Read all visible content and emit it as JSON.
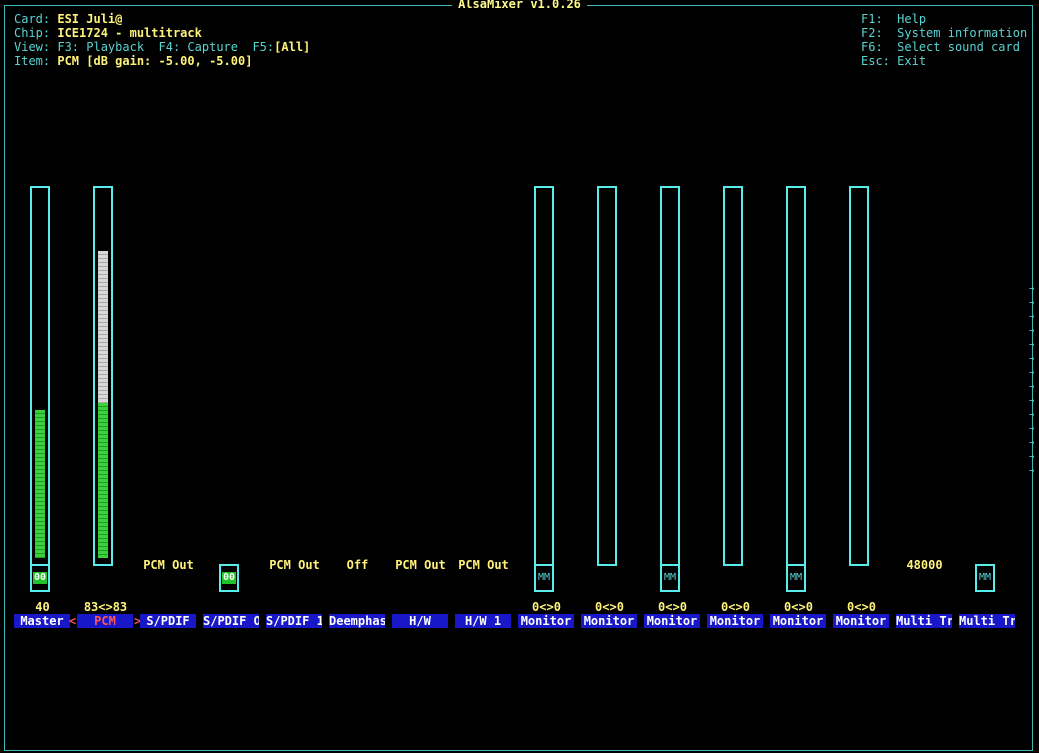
{
  "title": "AlsaMixer v1.0.26",
  "info": {
    "card_label": "Card:",
    "card": "ESI Juli@",
    "chip_label": "Chip:",
    "chip": "ICE1724 - multitrack",
    "view_label": "View:",
    "view_playback": "F3: Playback",
    "view_capture": "F4: Capture",
    "view_f5": "F5:",
    "view_all": "[All]",
    "item_label": "Item:",
    "item": "PCM [dB gain: -5.00, -5.00]"
  },
  "help": [
    {
      "key": "F1:",
      "label": "Help"
    },
    {
      "key": "F2:",
      "label": "System information"
    },
    {
      "key": "F6:",
      "label": "Select sound card"
    },
    {
      "key": "Esc:",
      "label": "Exit"
    }
  ],
  "channels": [
    {
      "name": "Master",
      "value": "40",
      "bar": {
        "green": 0.4
      },
      "switch": "00"
    },
    {
      "name": "PCM",
      "value": "83<>83",
      "bar": {
        "green": 0.42,
        "white": 0.83
      },
      "selected": true
    },
    {
      "name": "S/PDIF",
      "enum": "PCM Out"
    },
    {
      "name": "S/PDIF O",
      "switch": "00"
    },
    {
      "name": "S/PDIF 1",
      "enum": "PCM Out"
    },
    {
      "name": "Deemphas",
      "enum": "Off"
    },
    {
      "name": "H/W",
      "enum": "PCM Out"
    },
    {
      "name": "H/W 1",
      "enum": "PCM Out"
    },
    {
      "name": "Monitor",
      "value": "0<>0",
      "bar": {},
      "switch": "MM"
    },
    {
      "name": "Monitor",
      "value": "0<>0",
      "bar": {}
    },
    {
      "name": "Monitor",
      "value": "0<>0",
      "bar": {},
      "switch": "MM"
    },
    {
      "name": "Monitor",
      "value": "0<>0",
      "bar": {}
    },
    {
      "name": "Monitor",
      "value": "0<>0",
      "bar": {},
      "switch": "MM"
    },
    {
      "name": "Monitor",
      "value": "0<>0",
      "bar": {}
    },
    {
      "name": "Multi Tr",
      "enum": "48000"
    },
    {
      "name": "Multi Tr",
      "switch": "MM"
    }
  ],
  "selection_markers": {
    "left": "<",
    "right": ">"
  },
  "scroll_indicator": "→"
}
